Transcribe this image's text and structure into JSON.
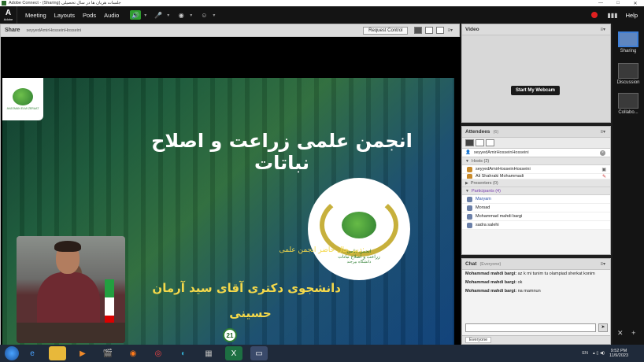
{
  "window": {
    "title": "Adobe Connect - (Sharing) جلسات هریان ها در سال تحصیلی",
    "minimize": "—",
    "maximize": "□",
    "close": "✕"
  },
  "app": {
    "logo": "A",
    "logo_sub": "Adobe"
  },
  "menus": [
    "Meeting",
    "Layouts",
    "Pods",
    "Audio"
  ],
  "menubar": {
    "help": "Help",
    "record_color": "#e02020"
  },
  "share_pod": {
    "title": "Share",
    "presenter": "seyyedAmirHosseinHosseini",
    "request_control": "Request Control",
    "menu_icon": "≡▾"
  },
  "slide": {
    "main_title": "انجمن علمی زراعت و اصلاح نباتات",
    "logo_line1": "انجمن علمی",
    "logo_line2": "زراعت و اصلاح نباتات",
    "logo_line3": "دانشگاه بیرجند",
    "corner_logo_caption": "ANJOMAN ELMI ZERAAT",
    "subtitle": "دبیر حال حاضر انجمن علمی:",
    "person_line1": "دانشجوی دکتری آقای سید آرمان",
    "person_line2": "حسینی",
    "page_number": "21"
  },
  "video_pod": {
    "title": "Video",
    "start_webcam": "Start My Webcam",
    "menu_icon": "≡▾"
  },
  "attendees_pod": {
    "title": "Attendees",
    "count": "(6)",
    "me": "seyyedAmirHosseinHosseini",
    "hosts_label": "Hosts (2)",
    "hosts": [
      {
        "name": "seyyedAmirHosseinHosseini"
      },
      {
        "name": "Ali Shahraki Mohammadi"
      }
    ],
    "presenters_label": "Presenters (0)",
    "participants_label": "Participants (4)",
    "participants": [
      {
        "name": "Maryam",
        "blue": true
      },
      {
        "name": "Morsad",
        "blue": false
      },
      {
        "name": "Mohammad mahdi bargi",
        "blue": false
      },
      {
        "name": "sadra salehi",
        "blue": false
      }
    ]
  },
  "chat_pod": {
    "title": "Chat",
    "scope": "(Everyone)",
    "messages": [
      {
        "author": "Mohammad mahdi bargi:",
        "text": "az k mi tunim tu olampiad sherkat konim"
      },
      {
        "author": "Mohammad mahdi bargi:",
        "text": "ok"
      },
      {
        "author": "Mohammad mahdi bargi:",
        "text": "na mamnun"
      }
    ],
    "input_placeholder": "",
    "footer_tab": "Everyone"
  },
  "layouts": [
    {
      "label": "Sharing",
      "active": true
    },
    {
      "label": "Discussion",
      "active": false
    },
    {
      "label": "Collabo...",
      "active": false
    }
  ],
  "taskbar": {
    "tray_lang": "EN",
    "time": "9:52 PM",
    "date": "11/9/2023",
    "icons": [
      "ie-icon",
      "folder-icon",
      "media-icon",
      "clapper-icon",
      "firefox-icon",
      "chrome-icon",
      "edge-icon",
      "app-icon",
      "terminal-icon",
      "adobe-connect-icon"
    ]
  }
}
